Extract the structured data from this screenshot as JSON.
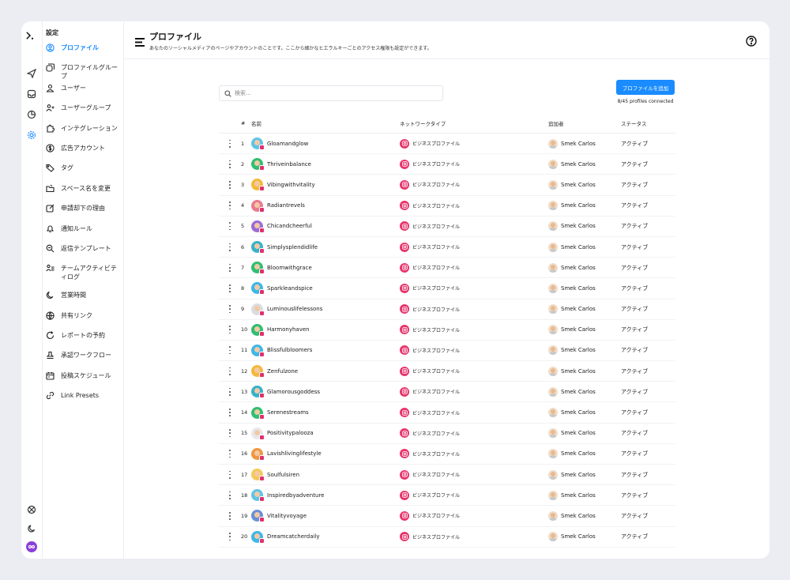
{
  "menu": {
    "title": "設定",
    "items": [
      {
        "label": "プロファイル",
        "icon": "profile-icon",
        "active": true
      },
      {
        "label": "プロファイルグループ",
        "icon": "profile-group-icon"
      },
      {
        "label": "ユーザー",
        "icon": "user-icon"
      },
      {
        "label": "ユーザーグループ",
        "icon": "user-group-icon"
      },
      {
        "label": "インテグレーション",
        "icon": "puzzle-icon"
      },
      {
        "label": "広告アカウント",
        "icon": "dollar-icon"
      },
      {
        "label": "タグ",
        "icon": "tag-icon"
      },
      {
        "label": "スペース名を変更",
        "icon": "folder-icon"
      },
      {
        "label": "申請却下の理由",
        "icon": "edit-icon"
      },
      {
        "label": "通知ルール",
        "icon": "bell-icon"
      },
      {
        "label": "返信テンプレート",
        "icon": "template-icon"
      },
      {
        "label": "チームアクティビティログ",
        "icon": "activity-icon"
      },
      {
        "label": "営業時間",
        "icon": "moon-icon"
      },
      {
        "label": "共有リンク",
        "icon": "globe-icon"
      },
      {
        "label": "レポートの予約",
        "icon": "refresh-icon"
      },
      {
        "label": "承認ワークフロー",
        "icon": "stamp-icon"
      },
      {
        "label": "投稿スケジュール",
        "icon": "calendar-icon"
      },
      {
        "label": "Link Presets",
        "icon": "link-icon"
      }
    ]
  },
  "header": {
    "title": "プロファイル",
    "subtitle": "あなたのソーシャルメディアのページやアカウントのことです。ここから細かなヒエラルキーごとのアクセス権限も設定ができます。"
  },
  "search": {
    "placeholder": "検索..."
  },
  "add_button": "プロファイルを追加",
  "connected": "8/45 profiles connected",
  "table": {
    "headers": {
      "num": "#",
      "name": "名前",
      "network": "ネットワークタイプ",
      "added_by": "追加者",
      "status": "ステータス"
    },
    "rows": [
      {
        "num": "1",
        "name": "Gloamandglow",
        "network": "ビジネスプロファイル",
        "added_by": "Smek Carlos",
        "status": "アクティブ",
        "color": "#5ec4e8"
      },
      {
        "num": "2",
        "name": "Thriveinbalance",
        "network": "ビジネスプロファイル",
        "added_by": "Smek Carlos",
        "status": "アクティブ",
        "color": "#2fbf71"
      },
      {
        "num": "3",
        "name": "Vibingwithvitality",
        "network": "ビジネスプロファイル",
        "added_by": "Smek Carlos",
        "status": "アクティブ",
        "color": "#f4b93a"
      },
      {
        "num": "4",
        "name": "Radiantrevels",
        "network": "ビジネスプロファイル",
        "added_by": "Smek Carlos",
        "status": "アクティブ",
        "color": "#e97a8f"
      },
      {
        "num": "5",
        "name": "Chicandcheerful",
        "network": "ビジネスプロファイル",
        "added_by": "Smek Carlos",
        "status": "アクティブ",
        "color": "#9b6bd6"
      },
      {
        "num": "6",
        "name": "Simplysplendidlife",
        "network": "ビジネスプロファイル",
        "added_by": "Smek Carlos",
        "status": "アクティブ",
        "color": "#36b3c9"
      },
      {
        "num": "7",
        "name": "Bloomwithgrace",
        "network": "ビジネスプロファイル",
        "added_by": "Smek Carlos",
        "status": "アクティブ",
        "color": "#2fbf71"
      },
      {
        "num": "8",
        "name": "Sparkleandspice",
        "network": "ビジネスプロファイル",
        "added_by": "Smek Carlos",
        "status": "アクティブ",
        "color": "#3fb7e6"
      },
      {
        "num": "9",
        "name": "Luminouslifelessons",
        "network": "ビジネスプロファイル",
        "added_by": "Smek Carlos",
        "status": "アクティブ",
        "color": "#d9dde3"
      },
      {
        "num": "10",
        "name": "Harmonyhaven",
        "network": "ビジネスプロファイル",
        "added_by": "Smek Carlos",
        "status": "アクティブ",
        "color": "#2fbf71"
      },
      {
        "num": "11",
        "name": "Blissfulbloomers",
        "network": "ビジネスプロファイル",
        "added_by": "Smek Carlos",
        "status": "アクティブ",
        "color": "#3fb7e6"
      },
      {
        "num": "12",
        "name": "Zenfulzone",
        "network": "ビジネスプロファイル",
        "added_by": "Smek Carlos",
        "status": "アクティブ",
        "color": "#f4b93a"
      },
      {
        "num": "13",
        "name": "Glamorousgoddess",
        "network": "ビジネスプロファイル",
        "added_by": "Smek Carlos",
        "status": "アクティブ",
        "color": "#36b3c9"
      },
      {
        "num": "14",
        "name": "Serenestreams",
        "network": "ビジネスプロファイル",
        "added_by": "Smek Carlos",
        "status": "アクティブ",
        "color": "#2fbf71"
      },
      {
        "num": "15",
        "name": "Positivitypalooza",
        "network": "ビジネスプロファイル",
        "added_by": "Smek Carlos",
        "status": "アクティブ",
        "color": "#e6e8ec"
      },
      {
        "num": "16",
        "name": "Lavishlivinglifestyle",
        "network": "ビジネスプロファイル",
        "added_by": "Smek Carlos",
        "status": "アクティブ",
        "color": "#f0963e"
      },
      {
        "num": "17",
        "name": "Soulfulsiren",
        "network": "ビジネスプロファイル",
        "added_by": "Smek Carlos",
        "status": "アクティブ",
        "color": "#f4c95a"
      },
      {
        "num": "18",
        "name": "Inspiredbyadventure",
        "network": "ビジネスプロファイル",
        "added_by": "Smek Carlos",
        "status": "アクティブ",
        "color": "#5ec4e8"
      },
      {
        "num": "19",
        "name": "Vitalityvoyage",
        "network": "ビジネスプロファイル",
        "added_by": "Smek Carlos",
        "status": "アクティブ",
        "color": "#6b8fd6"
      },
      {
        "num": "20",
        "name": "Dreamcatcherdaily",
        "network": "ビジネスプロファイル",
        "added_by": "Smek Carlos",
        "status": "アクティブ",
        "color": "#3fb7e6"
      }
    ]
  },
  "colors": {
    "accent": "#1a8cff",
    "instagram": "#e8336b",
    "background": "#ebedf3"
  }
}
